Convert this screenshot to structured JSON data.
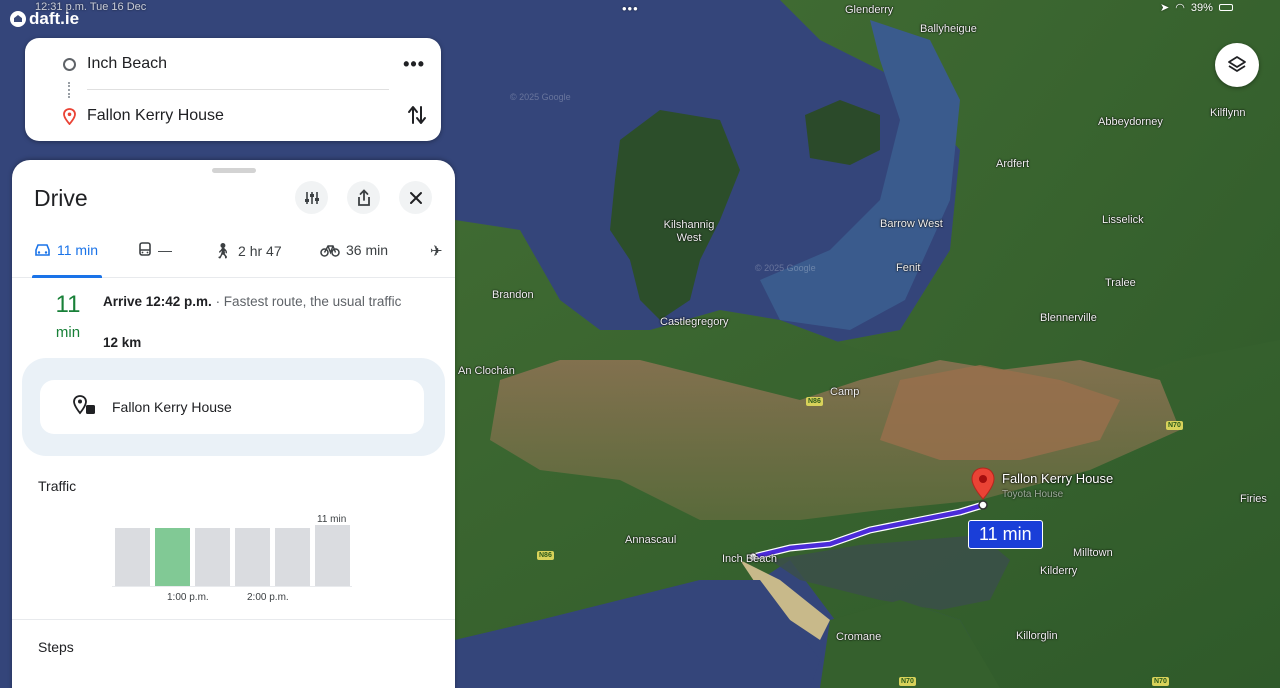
{
  "status_bar": {
    "time_date": "12:31 p.m.  Tue 16 Dec",
    "center_dots": "•••",
    "right": "39%",
    "brand": "daft.ie"
  },
  "directions": {
    "origin": "Inch Beach",
    "destination": "Fallon Kerry House",
    "more_label": "•••"
  },
  "sheet": {
    "title": "Drive",
    "modes": [
      {
        "name": "drive",
        "label": "11 min"
      },
      {
        "name": "transit",
        "label": "—"
      },
      {
        "name": "walk",
        "label": "2 hr 47"
      },
      {
        "name": "cycle",
        "label": "36 min"
      },
      {
        "name": "flight",
        "label": ""
      }
    ],
    "route": {
      "minutes": "11",
      "minutes_unit": "min",
      "arrive": "Arrive 12:42 p.m.",
      "summary": " · Fastest route, the usual traffic",
      "distance": "12 km"
    },
    "destination_label": "Fallon Kerry House",
    "traffic": {
      "title": "Traffic",
      "peak_label": "11 min",
      "bars": [
        {
          "level": 0.95,
          "current": false
        },
        {
          "level": 0.95,
          "current": true
        },
        {
          "level": 0.95,
          "current": false
        },
        {
          "level": 0.95,
          "current": false
        },
        {
          "level": 0.95,
          "current": false
        },
        {
          "level": 1.0,
          "current": false
        }
      ],
      "time_labels": [
        "1:00 p.m.",
        "2:00 p.m."
      ]
    },
    "steps_title": "Steps"
  },
  "map": {
    "places": [
      "Glenderry",
      "Ballyheigue",
      "Abbeydorney",
      "Kilflynn",
      "Ardfert",
      "Barrow West",
      "Lisselick",
      "Kilshannig West",
      "Fenit",
      "Tralee",
      "Brandon",
      "Castlegregory",
      "Blennerville",
      "An Clochán",
      "Camp",
      "Annascaul",
      "Inch Beach",
      "Firies",
      "Milltown",
      "Kilderry",
      "Cromane",
      "Killorglin"
    ],
    "road_badges": [
      "N86",
      "N70",
      "N86",
      "N70",
      "N70"
    ],
    "destination_label": "Fallon Kerry House",
    "destination_sub": "Toyota House",
    "eta": "11 min",
    "watermark": "© 2025 Google"
  },
  "colors": {
    "accent": "#1a73e8",
    "route": "#4b2bd9",
    "green": "#188038",
    "pin": "#ea4335"
  }
}
